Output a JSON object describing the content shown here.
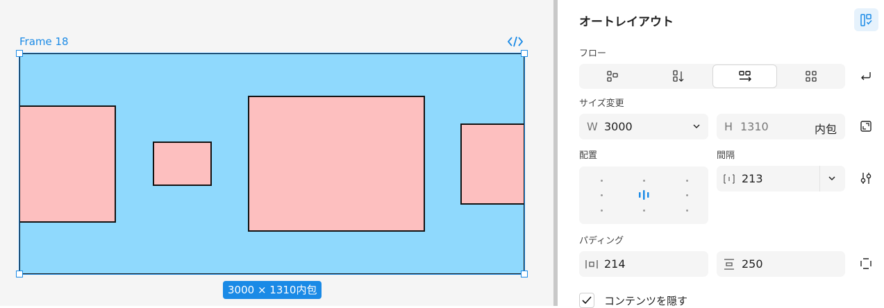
{
  "canvas": {
    "frame_name": "Frame 18",
    "size_badge": "3000 × 1310内包"
  },
  "panel": {
    "title": "オートレイアウト",
    "flow": {
      "label": "フロー",
      "options": [
        "grid-small-icon",
        "flow-vertical-icon",
        "flow-horizontal-icon",
        "grid-icon"
      ],
      "selected": 2
    },
    "resize": {
      "label": "サイズ変更",
      "w_label": "W",
      "w_value": "3000",
      "h_label": "H",
      "h_value": "1310",
      "h_mode": "内包"
    },
    "align": {
      "label": "配置",
      "selected": "center"
    },
    "gap": {
      "label": "間隔",
      "value": "213"
    },
    "padding": {
      "label": "パディング",
      "horizontal": "214",
      "vertical": "250"
    },
    "clip": {
      "label": "コンテンツを隠す",
      "checked": true
    }
  },
  "colors": {
    "accent": "#1a8ae6",
    "frame_fill": "#8fd9fd",
    "child_fill": "#fdbfbf"
  }
}
